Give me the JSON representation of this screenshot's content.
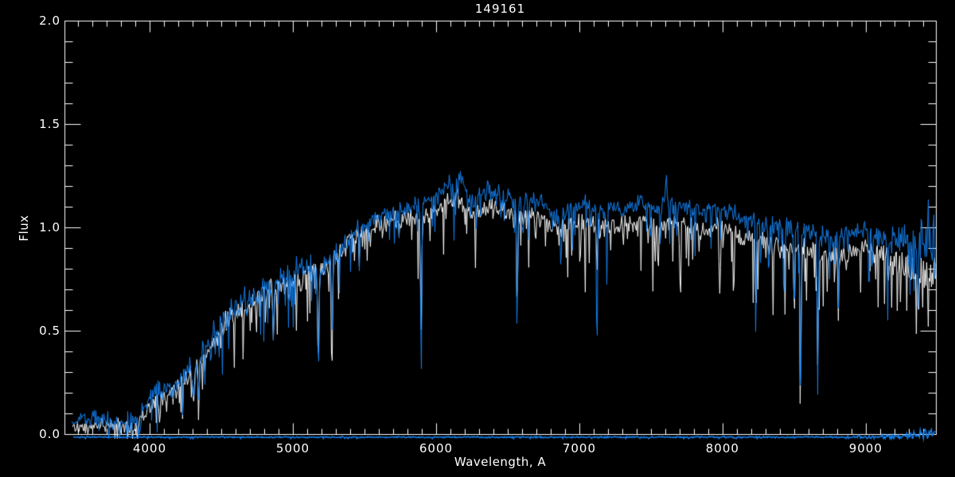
{
  "window": {
    "background": "#000000"
  },
  "chart_data": {
    "type": "line",
    "title": "149161",
    "xlabel": "Wavelength, A",
    "ylabel": "Flux",
    "xlim": [
      3405,
      9490
    ],
    "ylim": [
      0.0,
      2.0
    ],
    "grid": false,
    "legend": "none",
    "frame": true,
    "colors": {
      "background": "#000000",
      "axis": "#ffffff",
      "observed": "#1482f2",
      "template": "#ffffff"
    },
    "x_axis": {
      "label": "Wavelength, A",
      "major_ticks": [
        4000,
        5000,
        6000,
        7000,
        8000,
        9000
      ],
      "tick_labels": [
        "4000",
        "5000",
        "6000",
        "7000",
        "8000",
        "9000"
      ],
      "minor_step": 100
    },
    "y_axis": {
      "label": "Flux",
      "major_ticks": [
        0.0,
        0.5,
        1.0,
        1.5,
        2.0
      ],
      "tick_labels": [
        "0.0",
        "0.5",
        "1.0",
        "1.5",
        "2.0"
      ],
      "minor_step": 0.1
    },
    "series": [
      {
        "name": "template-spectrum",
        "color": "#ffffff",
        "line_width": 1,
        "start": 3460,
        "end": 9488,
        "continuum": [
          [
            3460,
            0.04
          ],
          [
            3700,
            0.05
          ],
          [
            3900,
            0.04
          ],
          [
            3980,
            0.13
          ],
          [
            4100,
            0.19
          ],
          [
            4200,
            0.24
          ],
          [
            4300,
            0.3
          ],
          [
            4400,
            0.39
          ],
          [
            4500,
            0.52
          ],
          [
            4600,
            0.59
          ],
          [
            4700,
            0.63
          ],
          [
            4800,
            0.67
          ],
          [
            4900,
            0.72
          ],
          [
            5000,
            0.75
          ],
          [
            5100,
            0.77
          ],
          [
            5200,
            0.79
          ],
          [
            5300,
            0.85
          ],
          [
            5400,
            0.94
          ],
          [
            5500,
            0.98
          ],
          [
            5600,
            1.02
          ],
          [
            5700,
            1.03
          ],
          [
            5800,
            1.04
          ],
          [
            5900,
            1.05
          ],
          [
            6000,
            1.08
          ],
          [
            6100,
            1.14
          ],
          [
            6150,
            1.16
          ],
          [
            6250,
            1.06
          ],
          [
            6350,
            1.1
          ],
          [
            6450,
            1.09
          ],
          [
            6550,
            1.05
          ],
          [
            6650,
            1.06
          ],
          [
            6750,
            1.04
          ],
          [
            6850,
            0.99
          ],
          [
            6950,
            1.02
          ],
          [
            7050,
            1.04
          ],
          [
            7150,
            1.0
          ],
          [
            7250,
            1.02
          ],
          [
            7350,
            1.02
          ],
          [
            7450,
            1.04
          ],
          [
            7550,
            1.01
          ],
          [
            7650,
            1.03
          ],
          [
            7750,
            1.01
          ],
          [
            7850,
            0.99
          ],
          [
            7950,
            1.01
          ],
          [
            8050,
            0.99
          ],
          [
            8150,
            0.95
          ],
          [
            8250,
            0.93
          ],
          [
            8350,
            0.93
          ],
          [
            8450,
            0.91
          ],
          [
            8550,
            0.91
          ],
          [
            8650,
            0.89
          ],
          [
            8750,
            0.86
          ],
          [
            8850,
            0.88
          ],
          [
            8950,
            0.9
          ],
          [
            9050,
            0.88
          ],
          [
            9150,
            0.85
          ],
          [
            9250,
            0.83
          ],
          [
            9350,
            0.8
          ],
          [
            9450,
            0.78
          ]
        ],
        "noise_amp": [
          [
            3460,
            0.03
          ],
          [
            3950,
            0.05
          ],
          [
            4300,
            0.07
          ],
          [
            5000,
            0.07
          ],
          [
            5500,
            0.06
          ],
          [
            6000,
            0.05
          ],
          [
            7000,
            0.05
          ],
          [
            8000,
            0.05
          ],
          [
            9000,
            0.06
          ],
          [
            9250,
            0.09
          ],
          [
            9490,
            0.16
          ]
        ],
        "spike_prob": 0.24,
        "spike_depth": [
          [
            3460,
            0.05
          ],
          [
            4200,
            0.22
          ],
          [
            4800,
            0.28
          ],
          [
            5500,
            0.25
          ],
          [
            6000,
            0.3
          ],
          [
            7000,
            0.33
          ],
          [
            8000,
            0.34
          ],
          [
            9000,
            0.3
          ],
          [
            9490,
            0.3
          ]
        ],
        "symmetric_after": 99999,
        "lines": [
          [
            4305,
            0.12,
            7
          ],
          [
            4340,
            0.16,
            4
          ],
          [
            4861,
            0.26,
            4
          ],
          [
            5175,
            0.44,
            5
          ],
          [
            5270,
            0.35,
            4
          ],
          [
            5893,
            0.58,
            4
          ],
          [
            6563,
            0.48,
            4
          ],
          [
            7120,
            0.3,
            3
          ],
          [
            8230,
            0.35,
            3
          ],
          [
            8498,
            0.42,
            3
          ],
          [
            8542,
            0.6,
            4
          ],
          [
            8662,
            0.55,
            4
          ],
          [
            8806,
            0.35,
            3
          ]
        ],
        "emission": []
      },
      {
        "name": "observed-spectrum",
        "color": "#1482f2",
        "line_width": 1,
        "start": 3455,
        "end": 9488,
        "continuum": [
          [
            3455,
            0.06
          ],
          [
            3600,
            0.08
          ],
          [
            3750,
            0.06
          ],
          [
            3900,
            0.06
          ],
          [
            3980,
            0.15
          ],
          [
            4050,
            0.22
          ],
          [
            4150,
            0.24
          ],
          [
            4250,
            0.28
          ],
          [
            4300,
            0.32
          ],
          [
            4400,
            0.42
          ],
          [
            4500,
            0.55
          ],
          [
            4600,
            0.62
          ],
          [
            4700,
            0.66
          ],
          [
            4800,
            0.7
          ],
          [
            4900,
            0.75
          ],
          [
            5000,
            0.78
          ],
          [
            5100,
            0.8
          ],
          [
            5200,
            0.82
          ],
          [
            5300,
            0.88
          ],
          [
            5400,
            0.98
          ],
          [
            5500,
            1.02
          ],
          [
            5600,
            1.07
          ],
          [
            5700,
            1.08
          ],
          [
            5800,
            1.1
          ],
          [
            5900,
            1.12
          ],
          [
            6000,
            1.15
          ],
          [
            6100,
            1.22
          ],
          [
            6150,
            1.25
          ],
          [
            6250,
            1.14
          ],
          [
            6350,
            1.18
          ],
          [
            6450,
            1.17
          ],
          [
            6550,
            1.12
          ],
          [
            6650,
            1.14
          ],
          [
            6750,
            1.12
          ],
          [
            6850,
            1.06
          ],
          [
            6950,
            1.1
          ],
          [
            7050,
            1.12
          ],
          [
            7150,
            1.08
          ],
          [
            7250,
            1.1
          ],
          [
            7350,
            1.1
          ],
          [
            7450,
            1.12
          ],
          [
            7550,
            1.1
          ],
          [
            7650,
            1.12
          ],
          [
            7750,
            1.1
          ],
          [
            7850,
            1.08
          ],
          [
            7950,
            1.1
          ],
          [
            8050,
            1.08
          ],
          [
            8150,
            1.04
          ],
          [
            8250,
            1.02
          ],
          [
            8350,
            1.02
          ],
          [
            8450,
            1.0
          ],
          [
            8550,
            1.0
          ],
          [
            8650,
            0.98
          ],
          [
            8750,
            0.95
          ],
          [
            8850,
            0.97
          ],
          [
            8950,
            1.0
          ],
          [
            9050,
            0.98
          ],
          [
            9150,
            0.95
          ],
          [
            9250,
            0.93
          ],
          [
            9350,
            0.9
          ],
          [
            9450,
            0.88
          ]
        ],
        "noise_amp": [
          [
            3455,
            0.035
          ],
          [
            3950,
            0.06
          ],
          [
            4300,
            0.08
          ],
          [
            5000,
            0.09
          ],
          [
            5500,
            0.07
          ],
          [
            6000,
            0.05
          ],
          [
            7000,
            0.05
          ],
          [
            8000,
            0.05
          ],
          [
            9000,
            0.06
          ],
          [
            9250,
            0.1
          ],
          [
            9490,
            0.25
          ]
        ],
        "spike_prob": 0.2,
        "spike_depth": [
          [
            3455,
            0.05
          ],
          [
            4200,
            0.25
          ],
          [
            4800,
            0.3
          ],
          [
            5300,
            0.28
          ],
          [
            5800,
            0.22
          ],
          [
            6500,
            0.22
          ],
          [
            7500,
            0.22
          ],
          [
            8500,
            0.25
          ],
          [
            9000,
            0.22
          ],
          [
            9490,
            0.35
          ]
        ],
        "symmetric_after": 9250,
        "lines": [
          [
            4226,
            0.16,
            3
          ],
          [
            4305,
            0.14,
            7
          ],
          [
            4340,
            0.18,
            4
          ],
          [
            4383,
            0.15,
            3
          ],
          [
            4861,
            0.28,
            4
          ],
          [
            5175,
            0.5,
            5
          ],
          [
            5270,
            0.4,
            4
          ],
          [
            5893,
            0.84,
            4
          ],
          [
            6122,
            0.22,
            3
          ],
          [
            6280,
            0.15,
            3
          ],
          [
            6563,
            0.64,
            4
          ],
          [
            6870,
            0.25,
            5
          ],
          [
            7120,
            0.88,
            3
          ],
          [
            7190,
            0.35,
            3
          ],
          [
            7680,
            0.2,
            3
          ],
          [
            8230,
            0.6,
            3
          ],
          [
            8320,
            0.3,
            3
          ],
          [
            8430,
            0.35,
            3
          ],
          [
            8498,
            0.5,
            3
          ],
          [
            8542,
            0.86,
            4
          ],
          [
            8662,
            0.78,
            4
          ],
          [
            8806,
            0.4,
            3
          ],
          [
            9020,
            0.4,
            3
          ],
          [
            9150,
            0.35,
            3
          ]
        ],
        "emission": [
          [
            7604,
            0.22,
            3
          ],
          [
            9435,
            0.28,
            2
          ],
          [
            9465,
            0.22,
            2
          ]
        ]
      },
      {
        "name": "noise-floor",
        "color": "#1482f2",
        "line_width": 1.5,
        "start": 3465,
        "end": 9488,
        "continuum": [
          [
            3465,
            -0.013
          ],
          [
            9000,
            -0.013
          ],
          [
            9200,
            -0.01
          ],
          [
            9350,
            -0.005
          ],
          [
            9490,
            0.01
          ]
        ],
        "noise_amp": [
          [
            3465,
            0.004
          ],
          [
            8800,
            0.005
          ],
          [
            9200,
            0.02
          ],
          [
            9490,
            0.035
          ]
        ],
        "spike_prob": 0.05,
        "spike_depth": [
          [
            3465,
            0.01
          ],
          [
            9490,
            0.04
          ]
        ],
        "symmetric_after": 9999,
        "lines": [],
        "emission": []
      }
    ]
  }
}
